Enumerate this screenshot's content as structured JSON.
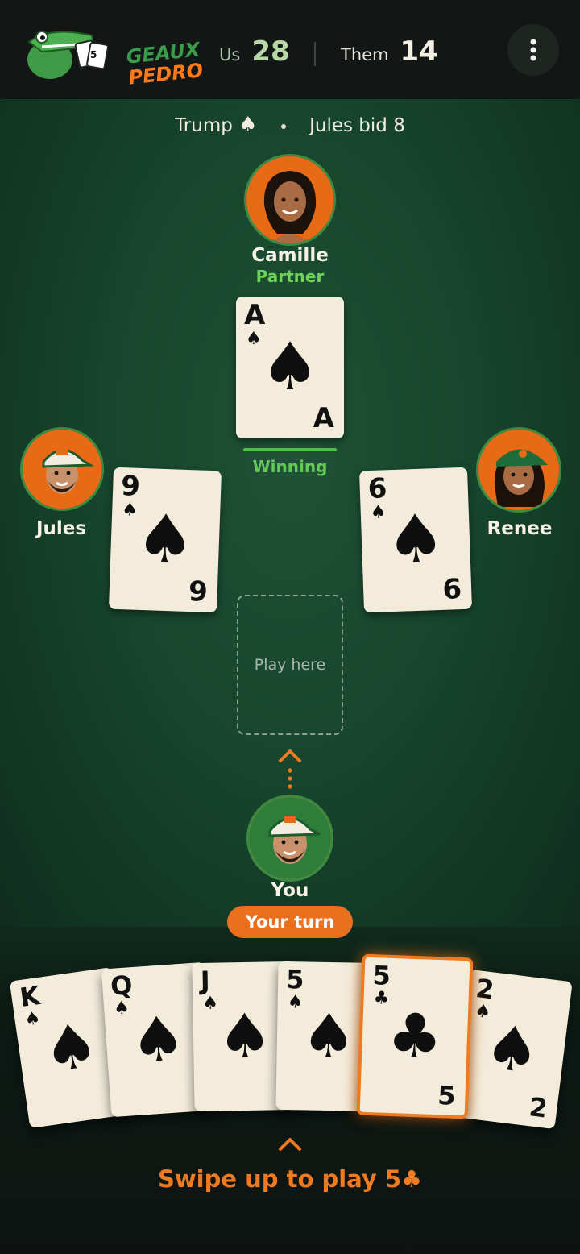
{
  "header": {
    "logo_line1": "GEAUX",
    "logo_line2": "PEDRO",
    "us_label": "Us",
    "us_score": "28",
    "them_label": "Them",
    "them_score": "14",
    "menu_icon": "more-vertical-icon"
  },
  "status": {
    "trump_label": "Trump",
    "trump_suit": "♠",
    "bid_text": "Jules bid 8"
  },
  "players": {
    "north": {
      "name": "Camille",
      "role": "Partner"
    },
    "west": {
      "name": "Jules"
    },
    "east": {
      "name": "Renee"
    },
    "south": {
      "name": "You"
    }
  },
  "trick": {
    "north_card": {
      "rank": "A",
      "suit": "♠"
    },
    "west_card": {
      "rank": "9",
      "suit": "♠"
    },
    "east_card": {
      "rank": "6",
      "suit": "♠"
    },
    "winning_label": "Winning",
    "play_zone_label": "Play here"
  },
  "turn_badge": "Your turn",
  "hand": [
    {
      "rank": "K",
      "suit": "♠"
    },
    {
      "rank": "Q",
      "suit": "♠"
    },
    {
      "rank": "J",
      "suit": "♠"
    },
    {
      "rank": "5",
      "suit": "♠"
    },
    {
      "rank": "5",
      "suit": "♣"
    },
    {
      "rank": "2",
      "suit": "♠"
    }
  ],
  "swipe_hint": "Swipe up to play 5♣",
  "colors": {
    "accent": "#e8701f",
    "felt": "#17452d",
    "winning": "#4fbf4a"
  }
}
